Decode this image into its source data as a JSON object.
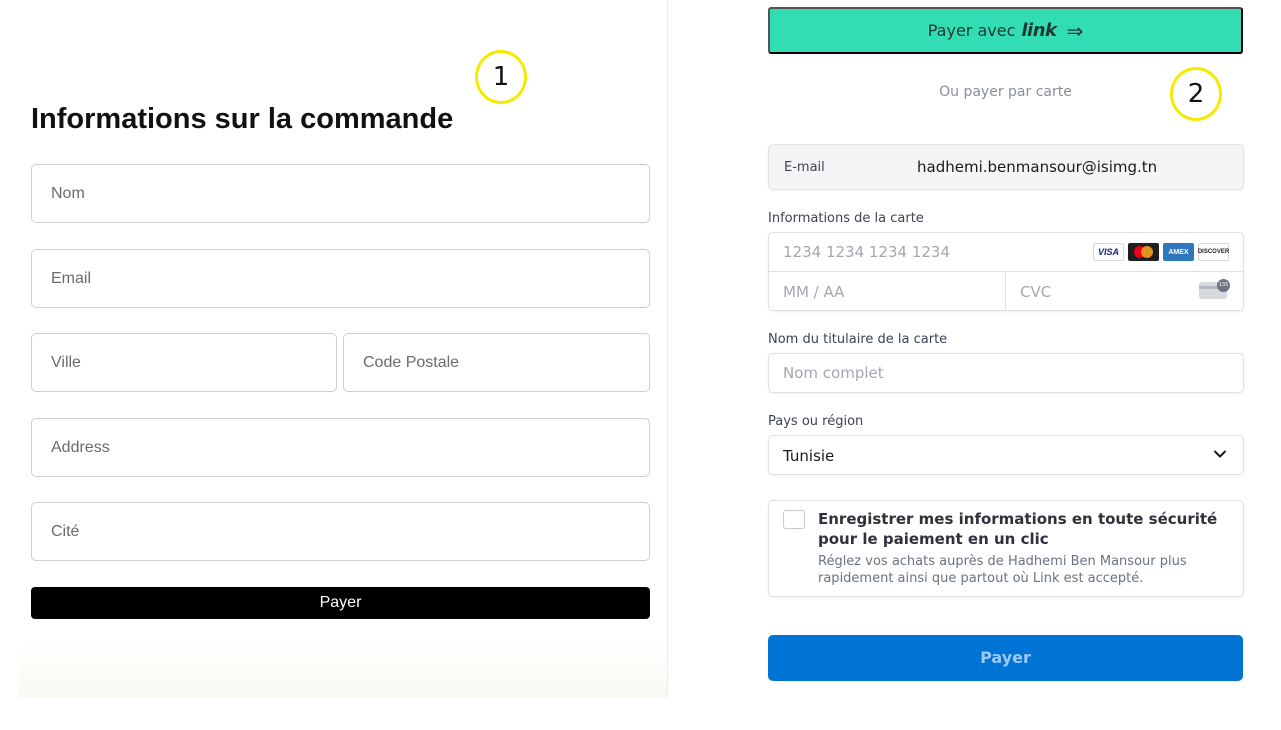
{
  "left_form": {
    "title": "Informations sur la commande",
    "nom_placeholder": "Nom",
    "email_placeholder": "Email",
    "ville_placeholder": "Ville",
    "code_postale_placeholder": "Code Postale",
    "address_placeholder": "Address",
    "cite_placeholder": "Cité",
    "pay_label": "Payer"
  },
  "markers": {
    "one": "1",
    "two": "2"
  },
  "stripe": {
    "link_button": {
      "text": "Payer avec",
      "brand": "link",
      "icon": "arrow-right-icon"
    },
    "or_text": "Ou payer par carte",
    "email": {
      "label": "E-mail",
      "value": "hadhemi.benmansour@isimg.tn"
    },
    "card": {
      "label": "Informations de la carte",
      "number_placeholder": "1234 1234 1234 1234",
      "expiry_placeholder": "MM / AA",
      "cvc_placeholder": "CVC",
      "brands": [
        "VISA",
        "mastercard",
        "AMEX",
        "DISCOVER"
      ]
    },
    "holder": {
      "label": "Nom du titulaire de la carte",
      "placeholder": "Nom complet"
    },
    "country": {
      "label": "Pays ou région",
      "value": "Tunisie"
    },
    "save": {
      "title": "Enregistrer mes informations en toute sécurité pour le paiement en un clic",
      "description": "Réglez vos achats auprès de Hadhemi Ben Mansour plus rapidement ainsi que partout où Link est accepté."
    },
    "pay_label": "Payer"
  },
  "colors": {
    "link_green": "#33ddb3",
    "pay_blue": "#0074d4",
    "marker_yellow": "#f5eb00",
    "black_button": "#000000"
  }
}
